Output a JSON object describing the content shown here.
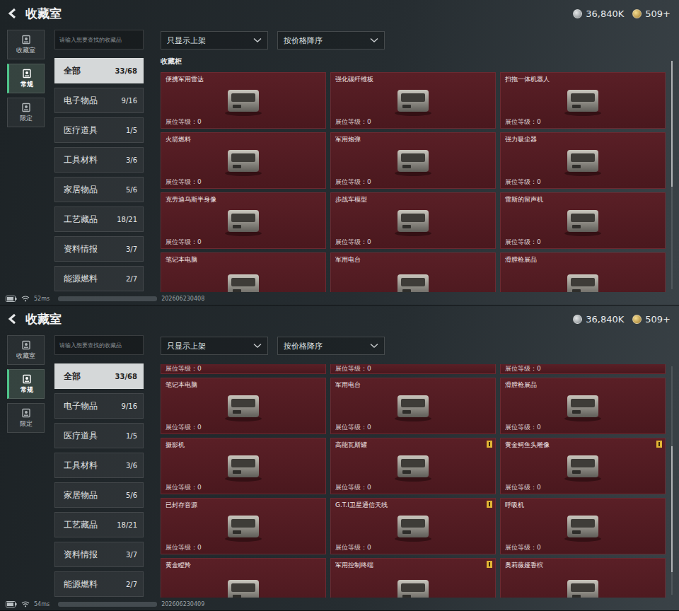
{
  "screens": [
    {
      "header": {
        "title": "收藏室",
        "currencies": [
          {
            "amount": "36,840K",
            "kind": "silver"
          },
          {
            "amount": "509+",
            "kind": "gold"
          }
        ]
      },
      "nav": [
        {
          "label": "收藏室",
          "selected": false
        },
        {
          "label": "常规",
          "selected": true
        },
        {
          "label": "限定",
          "selected": false
        }
      ],
      "search": {
        "placeholder": "请输入想要查找的收藏品"
      },
      "categories": [
        {
          "label": "全部",
          "count": "33/68",
          "selected": true
        },
        {
          "label": "电子物品",
          "count": "9/16",
          "selected": false
        },
        {
          "label": "医疗道具",
          "count": "1/5",
          "selected": false
        },
        {
          "label": "工具材料",
          "count": "3/6",
          "selected": false
        },
        {
          "label": "家居物品",
          "count": "5/6",
          "selected": false
        },
        {
          "label": "工艺藏品",
          "count": "18/21",
          "selected": false
        },
        {
          "label": "资料情报",
          "count": "3/7",
          "selected": false
        },
        {
          "label": "能源燃料",
          "count": "2/7",
          "selected": false
        }
      ],
      "filters": [
        "只显示上架",
        "按价格降序"
      ],
      "section_title": "收藏柜",
      "scroll_position": 0.0,
      "cards": [
        {
          "kind": "full",
          "name": "便携军用雷达",
          "level": "展位等级：0",
          "badge": false
        },
        {
          "kind": "full",
          "name": "强化碳纤维板",
          "level": "展位等级：0",
          "badge": false
        },
        {
          "kind": "full",
          "name": "扫拖一体机器人",
          "level": "展位等级：0",
          "badge": false
        },
        {
          "kind": "full",
          "name": "火箭燃料",
          "level": "展位等级：0",
          "badge": false
        },
        {
          "kind": "full",
          "name": "军用炮弹",
          "level": "展位等级：0",
          "badge": false
        },
        {
          "kind": "full",
          "name": "强力吸尘器",
          "level": "展位等级：0",
          "badge": false
        },
        {
          "kind": "full",
          "name": "克劳迪乌斯半身像",
          "level": "展位等级：0",
          "badge": false
        },
        {
          "kind": "full",
          "name": "步战车模型",
          "level": "展位等级：0",
          "badge": false
        },
        {
          "kind": "full",
          "name": "雷斯的留声机",
          "level": "展位等级：0",
          "badge": false
        },
        {
          "kind": "cut",
          "name": "笔记本电脑",
          "badge": false
        },
        {
          "kind": "cut",
          "name": "军用电台",
          "badge": false
        },
        {
          "kind": "cut",
          "name": "滑膛枪展品",
          "badge": false
        }
      ],
      "status": {
        "latency": "52ms",
        "id": "202606230408"
      }
    },
    {
      "header": {
        "title": "收藏室",
        "currencies": [
          {
            "amount": "36,840K",
            "kind": "silver"
          },
          {
            "amount": "509+",
            "kind": "gold"
          }
        ]
      },
      "nav": [
        {
          "label": "收藏室",
          "selected": false
        },
        {
          "label": "常规",
          "selected": true
        },
        {
          "label": "限定",
          "selected": false
        }
      ],
      "search": {
        "placeholder": "请输入想要查找的收藏品"
      },
      "categories": [
        {
          "label": "全部",
          "count": "33/68",
          "selected": true
        },
        {
          "label": "电子物品",
          "count": "9/16",
          "selected": false
        },
        {
          "label": "医疗道具",
          "count": "1/5",
          "selected": false
        },
        {
          "label": "工具材料",
          "count": "3/6",
          "selected": false
        },
        {
          "label": "家居物品",
          "count": "5/6",
          "selected": false
        },
        {
          "label": "工艺藏品",
          "count": "18/21",
          "selected": false
        },
        {
          "label": "资料情报",
          "count": "3/7",
          "selected": false
        },
        {
          "label": "能源燃料",
          "count": "2/7",
          "selected": false
        }
      ],
      "filters": [
        "只显示上架",
        "按价格降序"
      ],
      "scroll_position": 0.35,
      "cards": [
        {
          "kind": "stub",
          "level": "展位等级：0",
          "badge": false
        },
        {
          "kind": "stub",
          "level": "展位等级：0",
          "badge": false
        },
        {
          "kind": "stub",
          "level": "展位等级：0",
          "badge": false
        },
        {
          "kind": "full",
          "name": "笔记本电脑",
          "level": "展位等级：0",
          "badge": false
        },
        {
          "kind": "full",
          "name": "军用电台",
          "level": "展位等级：0",
          "badge": false
        },
        {
          "kind": "full",
          "name": "滑膛枪展品",
          "level": "展位等级：0",
          "badge": false
        },
        {
          "kind": "full",
          "name": "摄影机",
          "level": "展位等级：0",
          "badge": false
        },
        {
          "kind": "full",
          "name": "高能瓦斯罐",
          "level": "展位等级：0",
          "badge": true
        },
        {
          "kind": "full",
          "name": "黄金鳄鱼头雕像",
          "level": "展位等级：0",
          "badge": true
        },
        {
          "kind": "full",
          "name": "已封存音源",
          "level": "展位等级：0",
          "badge": false
        },
        {
          "kind": "full",
          "name": "G.T.I卫星通信天线",
          "level": "展位等级：0",
          "badge": true
        },
        {
          "kind": "full",
          "name": "呼吸机",
          "level": "展位等级：0",
          "badge": false
        },
        {
          "kind": "cut",
          "name": "黄金瞪羚",
          "badge": false
        },
        {
          "kind": "cut",
          "name": "军用控制终端",
          "badge": true
        },
        {
          "kind": "cut",
          "name": "奥莉薇娅香槟",
          "badge": false
        }
      ],
      "status": {
        "latency": "54ms",
        "id": "202606230409"
      }
    }
  ]
}
